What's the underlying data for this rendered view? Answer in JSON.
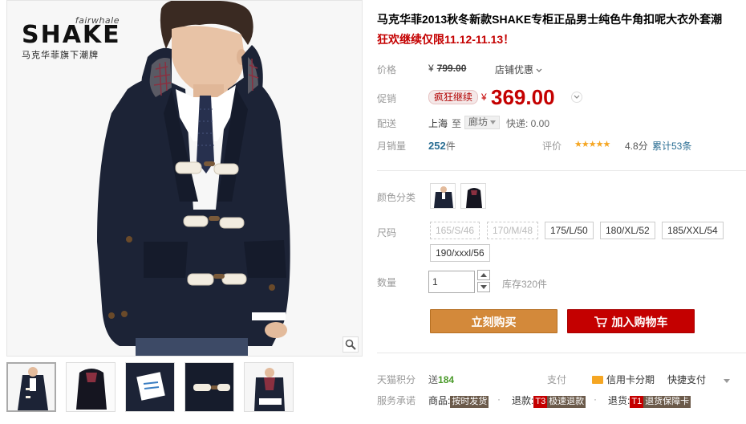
{
  "brand": {
    "small": "fairwhale",
    "big": "SHAKE",
    "cn": "马克华菲旗下潮牌"
  },
  "product": {
    "title": "马克华菲2013秋冬新款SHAKE专柜正品男士纯色牛角扣呢大衣外套潮",
    "promo": "狂欢继续仅限11.12-11.13！"
  },
  "price": {
    "label": "价格",
    "yen": "¥",
    "original": "799.00",
    "shop_discount": "店铺优惠"
  },
  "promotion": {
    "label": "促销",
    "tag": "疯狂继续",
    "yen": "¥",
    "price": "369.00"
  },
  "shipping": {
    "label": "配送",
    "from": "上海",
    "to": "至",
    "city": "廊坊",
    "fee": "快递: 0.00"
  },
  "sales": {
    "label": "月销量",
    "count": "252",
    "unit": "件",
    "rating_label": "评价",
    "stars": "★★★★★",
    "rating": "4.8分",
    "review_count": "累计53条"
  },
  "color": {
    "label": "颜色分类"
  },
  "size": {
    "label": "尺码",
    "options": [
      "165/S/46",
      "170/M/48",
      "175/L/50",
      "180/XL/52",
      "185/XXL/54",
      "190/xxxl/56"
    ]
  },
  "quantity": {
    "label": "数量",
    "value": "1",
    "stock": "库存320件"
  },
  "actions": {
    "buy_now": "立刻购买",
    "add_cart": "加入购物车"
  },
  "points": {
    "label": "天猫积分",
    "prefix": "送",
    "value": "184",
    "pay_label": "支付",
    "credit": "信用卡分期",
    "fast": "快捷支付"
  },
  "service": {
    "label": "服务承诺",
    "goods": "商品:",
    "goods_badge": "按时发货",
    "refund": "退款:",
    "refund_t": "T3",
    "refund_badge": "极速退款",
    "return": "退货:",
    "return_t": "T1",
    "return_badge": "退货保障卡"
  },
  "colors": {
    "price_red": "#c40000",
    "buy_orange": "#d3893a",
    "link_blue": "#2a6e93",
    "star": "#f5a623"
  }
}
